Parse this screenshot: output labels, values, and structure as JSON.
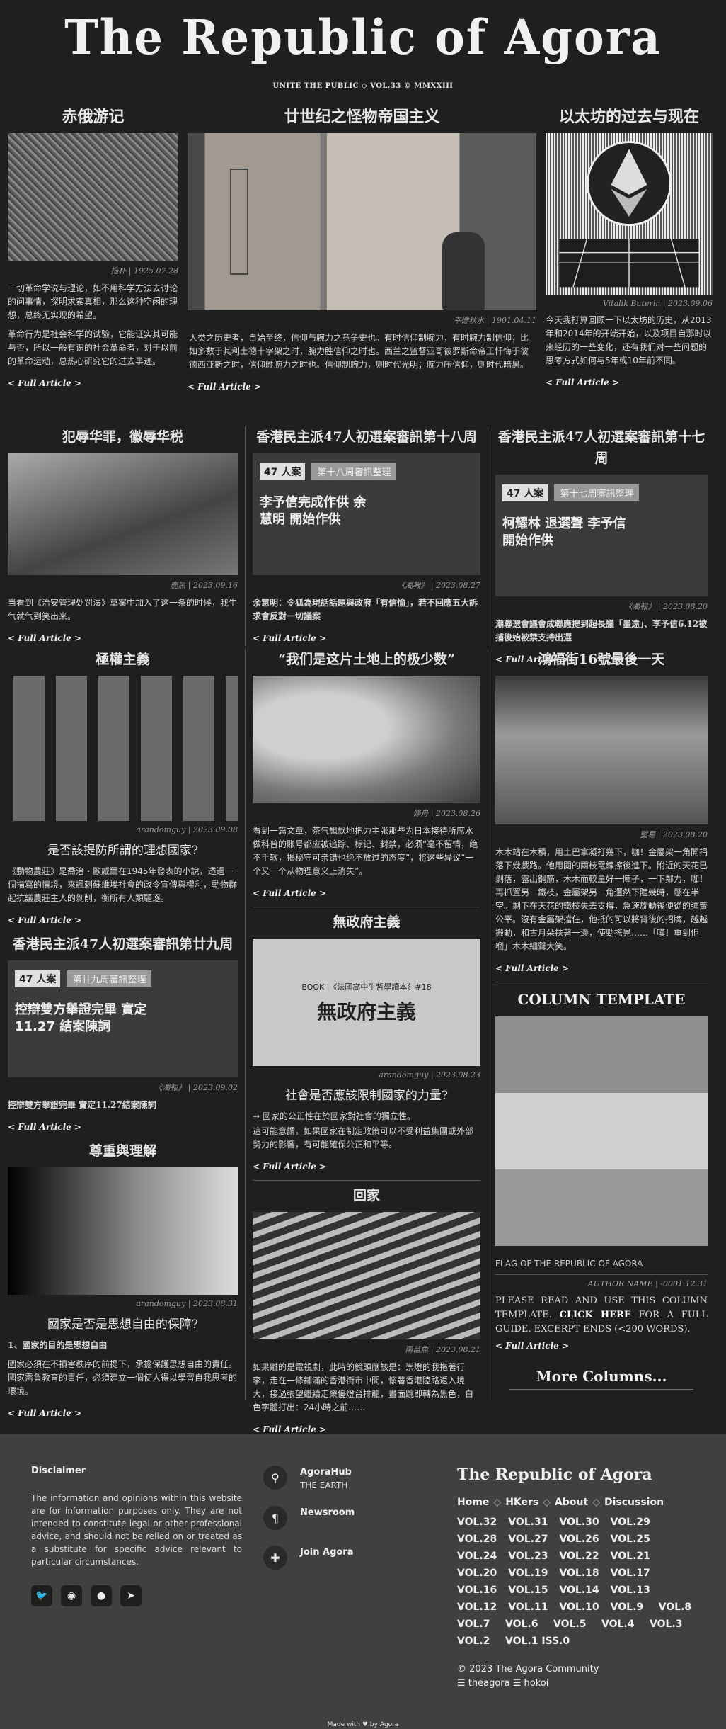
{
  "masthead": {
    "title": "The Republic of Agora",
    "tagline": "UNITE THE PUBLIC ◇ VOL.33 © MMXXIII"
  },
  "link_label": "< Full Article >",
  "top": [
    {
      "title": "赤俄游记",
      "byline": "拖朴 | 1925.07.28",
      "paras": [
        "一切革命学说与理论，如不用科学方法去讨论的问事情，探明求索真相，那么这种空闲的理想，总终无实现的希望。",
        "革命行为是社会科学的试验，它能证实其可能与否，所以一般有识的社会革命者，对于以前的革命运动，总热心研究它的过去事迹。"
      ]
    },
    {
      "title": "廿世纪之怪物帝国主义",
      "byline": "幸德秋水 | 1901.04.11",
      "paras": [
        "人类之历史者，自始至终，信仰与腕力之竞争史也。有时信仰制腕力，有时腕力制信仰；比如多数于其利土德十字架之时，腕力胜信仰之时也。西兰之监督亚哥彼罗斯命帝王忏悔于彼德西亚斯之时，信仰胜腕力之时也。信仰制腕力，则时代光明；腕力压信仰，则时代暗黑。"
      ]
    },
    {
      "title": "以太坊的过去与现在",
      "byline": "Vitalik Buterin | 2023.09.06",
      "paras": [
        "今天我打算回顾一下以太坊的历史，从2013年和2014年的开端开始，以及项目自那时以来经历的一些变化，还有我们对一些问题的思考方式如何与5年或10年前不同。"
      ]
    }
  ],
  "mid": [
    {
      "title": "犯辱华罪，徽辱华税",
      "byline": "鹿黑 | 2023.09.16",
      "paras": [
        "当看到《治安管理处罚法》草案中加入了这一条的时候，我生气就气到笑出来。"
      ]
    },
    {
      "title": "香港民主派47人初選案審訊第十八周",
      "poster_badge": "47 人案",
      "poster_bar": "第十八周審訊整理",
      "poster_text": "李予信完成作供 余慧明 開始作供",
      "byline": "《濁報》 | 2023.08.27",
      "paras": [
        "余慧明：令狐為現話話題與政府「有信愉」，若不回應五大訴求會反對一切議案"
      ]
    },
    {
      "title": "香港民主派47人初選案審訊第十七周",
      "poster_badge": "47 人案",
      "poster_bar": "第十七周審訊整理",
      "poster_text": "柯耀林 退選聲 李予信 開始作供",
      "byline": "《濁報》 | 2023.08.20",
      "paras": [
        "潮聯選會議會成聯應提到超長議「墨遠」、李予信6.12被捕後始被禁支持出選"
      ]
    }
  ],
  "col1": [
    {
      "title": "極權主義",
      "byline": "arandomguy | 2023.09.08",
      "sub": "是否該提防所謂的理想國家?",
      "paras": [
        "《動物農莊》是喬治・歐威爾在1945年發表的小說，透過一個描寫的情境，來諷刺蘇維埃社會的政令宣傳與權利，動物群起抗議農莊主人的剝削，衡所有人類驅逐。"
      ]
    },
    {
      "title": "香港民主派47人初選案審訊第廿九周",
      "poster_badge": "47 人案",
      "poster_bar": "第廿九周審訊整理",
      "poster_text": "控辯雙方舉證完畢 實定 11.27 結案陳詞",
      "byline": "《濁報》 | 2023.09.02",
      "paras": [
        "控辯雙方舉證完畢 實定11.27結案陳詞"
      ]
    },
    {
      "title": "尊重與理解",
      "byline": "arandomguy | 2023.08.31",
      "sub": "國家是否是思想自由的保障?",
      "lead": "1、國家的目的是思想自由",
      "paras": [
        "國家必須在不損害秩序的前提下，承擔保護思想自由的責任。國家需負教育的責任，必須建立一個使人得以學習自我思考的環境。"
      ]
    }
  ],
  "col2": [
    {
      "title": "“我们是这片土地上的极少数”",
      "byline": "條舟 | 2023.08.26",
      "paras": [
        "看到一篇文章，茶气飘飘地把力主张那些为日本接待所席水做科普的账号都应被追踪、标记、封禁，必须“毫不留情，绝不手软，揭秘守可亲错也绝不放过的态度”，将这些异议“一个又一个从物理意义上消失”。"
      ]
    },
    {
      "title": "無政府主義",
      "book_line": "BOOK |《法國高中生哲學讀本》#18",
      "book_title": "無政府主義",
      "byline": "arandomguy | 2023.08.23",
      "sub": "社會是否應該限制國家的力量?",
      "paras": [
        "→ 國家的公正性在於國家對社會的獨立性。",
        "這可能意謂，如果國家在制定政策可以不受利益集團或外部勢力的影響，有可能確保公正和平等。"
      ]
    },
    {
      "title": "回家",
      "byline": "兩苗魚 | 2023.08.21",
      "paras": [
        "如果離的是電視劇，此時的鏡頭應該是：崇燈的我拖著行李，走在一條鋪滿的香港街市中間，懷著香港陸路返入境大，接過張望繼續走樂優燈台排龍，畫面跳即轉為黑色，白色字體打出：24小時之前……"
      ]
    }
  ],
  "col3": [
    {
      "title": "鴻福街16號最後一天",
      "byline": "壁易 | 2023.08.20",
      "paras": [
        "木木站在木積，用土巴拿凝打幾下，咖！金屬架一角開捐落下幾戲路。他用閱的兩枝電線擦後進下。附近的天花已剝落，露出鋼筋，木木而較量好一陣子，一下鄰力，咖！再抓置另一鐵枝，金屬架另一角還然下陸幾時，懸在半空。剩下在天花的鐵枝失去支撐，急速旋動後便從的彈簧公平。沒有金屬架擋住，他抵的可以將背後的招牌，越越搬動，和古月朵扶著一邊，使勁搖晃……「嘆！重到佢嗰」木木細聲大笑。"
      ]
    }
  ],
  "column_template": {
    "title": "COLUMN TEMPLATE",
    "caption": "FLAG OF THE REPUBLIC OF AGORA",
    "author": "AUTHOR NAME | -0001.12.31",
    "body_pre": "PLEASE READ AND USE THIS COLUMN TEMPLATE.",
    "body_link": "CLICK HERE",
    "body_post": "FOR A FULL GUIDE. EXCERPT ENDS (<200 WORDS).",
    "more_columns": "More Columns..."
  },
  "footer": {
    "disclaimer_title": "Disclaimer",
    "disclaimer_text": "The information and opinions within this website are for information purposes only. They are not intended to constitute legal or other professional advice, and should not be relied on or treated as a substitute for specific advice relevant to particular circumstances.",
    "socials": [
      "twitter-icon",
      "github-icon",
      "reddit-icon",
      "telegram-icon"
    ],
    "links": [
      {
        "label": "AgoraHub",
        "sub": "THE EARTH",
        "icon": "location-icon"
      },
      {
        "label": "Newsroom",
        "sub": "",
        "icon": "paragraph-icon"
      },
      {
        "label": "Join Agora",
        "sub": "",
        "icon": "puzzle-icon"
      }
    ],
    "brand": "The Republic of Agora",
    "nav": [
      "Home",
      "HKers",
      "About",
      "Discussion"
    ],
    "vols": [
      "VOL.32",
      "VOL.31",
      "VOL.30",
      "VOL.29",
      "VOL.28",
      "VOL.27",
      "VOL.26",
      "VOL.25",
      "VOL.24",
      "VOL.23",
      "VOL.22",
      "VOL.21",
      "VOL.20",
      "VOL.19",
      "VOL.18",
      "VOL.17",
      "VOL.16",
      "VOL.15",
      "VOL.14",
      "VOL.13",
      "VOL.12",
      "VOL.11",
      "VOL.10",
      "VOL.9",
      "VOL.8",
      "VOL.7",
      "VOL.6",
      "VOL.5",
      "VOL.4",
      "VOL.3",
      "VOL.2",
      "VOL.1 ISS.0"
    ],
    "copyright": "© 2023 The Agora Community",
    "credits": "☰ theagora ☰ hokoi",
    "made_with": "Made with ♥ by Agora"
  }
}
